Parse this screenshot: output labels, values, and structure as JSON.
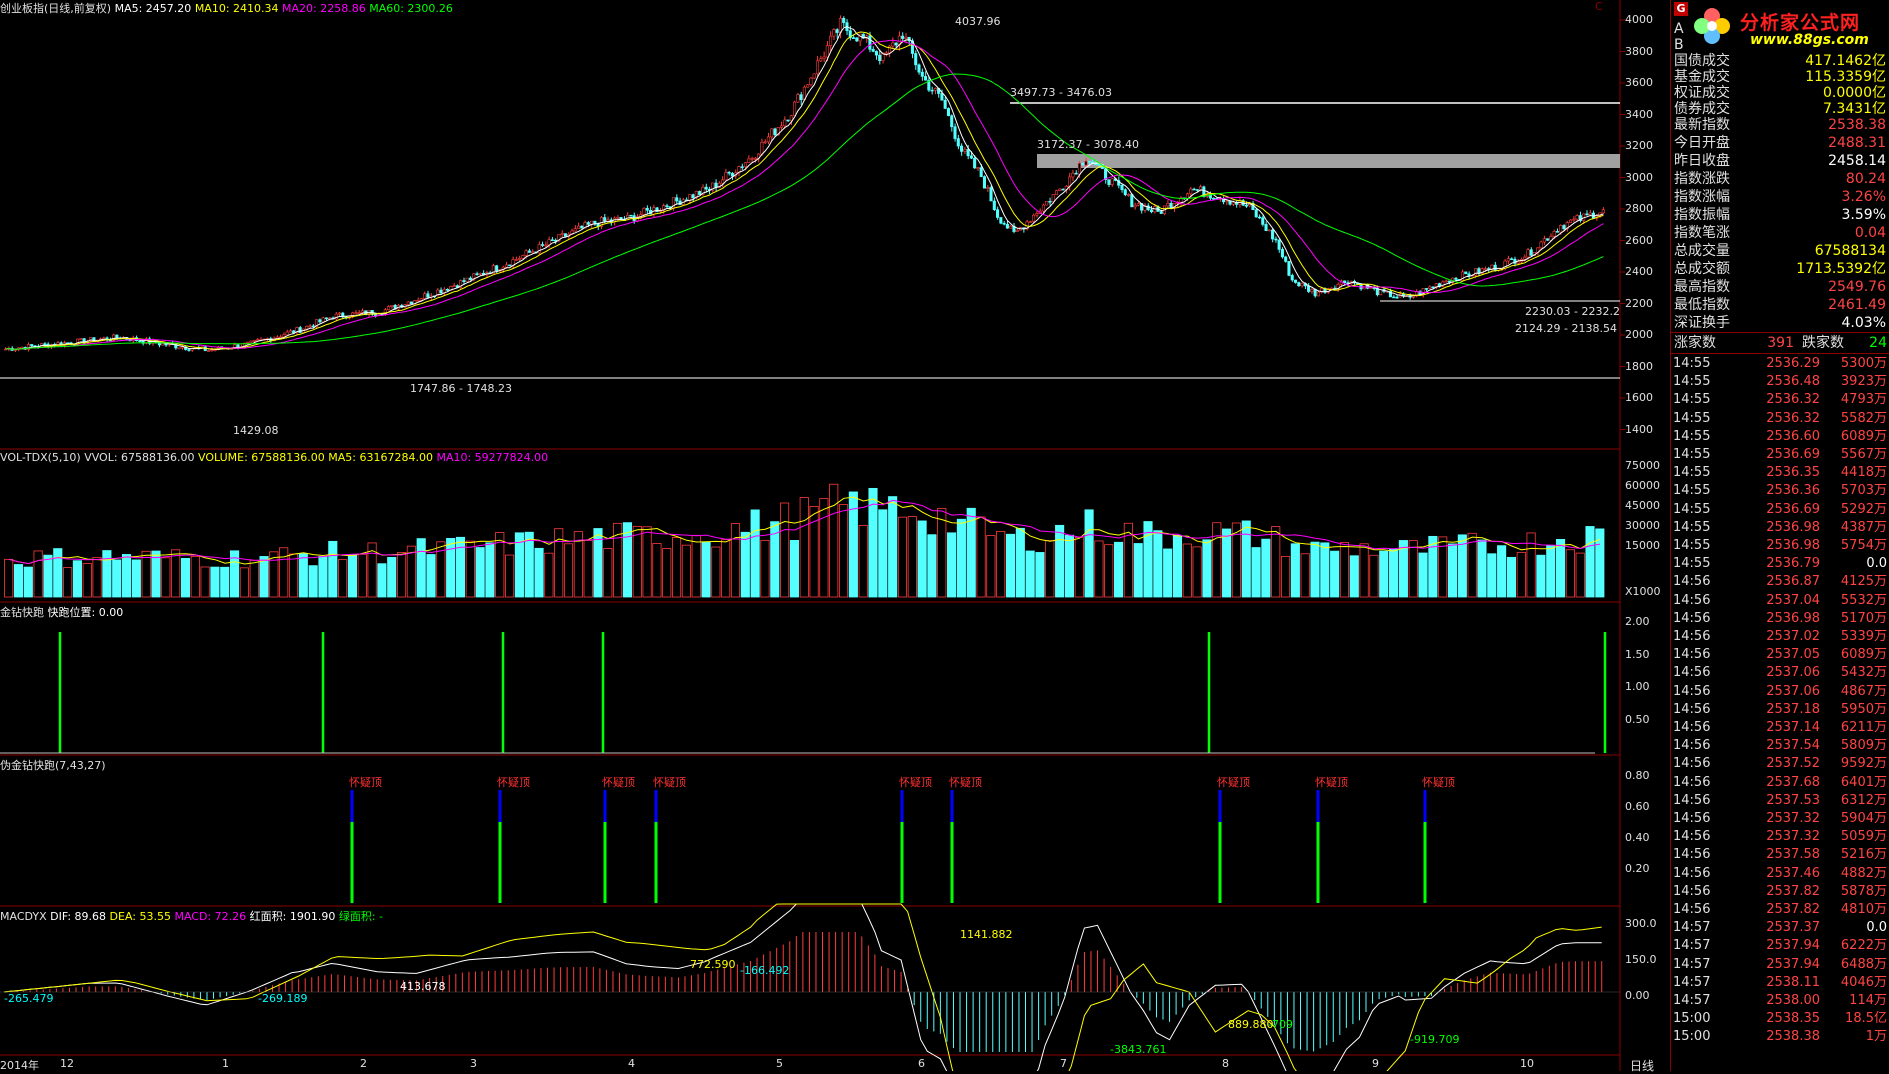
{
  "main_panel": {
    "title": "创业板指(日线,前复权)",
    "ma": [
      {
        "label": "MA5: 2457.20",
        "color": "#ffffff"
      },
      {
        "label": "MA10: 2410.34",
        "color": "#ffff00"
      },
      {
        "label": "MA20: 2258.86",
        "color": "#ff00ff"
      },
      {
        "label": "MA60: 2300.26",
        "color": "#00ff00"
      }
    ],
    "price_axis": [
      "4000",
      "3800",
      "3600",
      "3400",
      "3200",
      "3000",
      "2800",
      "2600",
      "2400",
      "2200",
      "2000",
      "1800",
      "1600",
      "1400"
    ],
    "annotations": [
      "4037.96",
      "3497.73 - 3476.03",
      "3172.37 - 3078.40",
      "1747.86 - 1748.23",
      "1429.08",
      "2230.03 - 2232.2",
      "2124.29 - 2138.54"
    ]
  },
  "vol_panel": {
    "title": "VOL-TDX(5,10)",
    "vvol": "VVOL: 67588136.00",
    "volume": "VOLUME: 67588136.00",
    "ma5": "MA5: 63167284.00",
    "ma10": "MA10: 59277824.00",
    "axis": [
      "75000",
      "60000",
      "45000",
      "30000",
      "15000"
    ],
    "unit": "X1000"
  },
  "jzkp_panel": {
    "title": "金钻快跑",
    "pos": "快跑位置: 0.00",
    "axis": [
      "2.00",
      "1.50",
      "1.00",
      "0.50"
    ]
  },
  "fjz_panel": {
    "title": "伪金钻快跑(7,43,27)",
    "signal_label": "怀疑顶",
    "axis": [
      "0.80",
      "0.60",
      "0.40",
      "0.20"
    ]
  },
  "macd_panel": {
    "title": "MACDYX",
    "dif": "DIF: 89.68",
    "dea": "DEA: 53.55",
    "macd": "MACD: 72.26",
    "red_area": "红面积: 1901.90",
    "green_area": "绿面积: -",
    "axis": [
      "300.0",
      "150.0",
      "0.00"
    ],
    "annotations": [
      "1141.882",
      "772.590",
      "-166.492",
      "-265.479",
      "-269.189",
      "413.678",
      "889.880",
      "-709",
      "-3843.761",
      "-919.709"
    ]
  },
  "date_axis": [
    "2014年",
    "12",
    "1",
    "2",
    "3",
    "4",
    "5",
    "6",
    "7",
    "8",
    "9",
    "10"
  ],
  "period_label": "日线",
  "top_right_label": "C",
  "logo": {
    "title": "分析家公式网",
    "url": "www.88gs.com"
  },
  "side_panel": {
    "badge": "G",
    "rows_top": [
      {
        "label": "A",
        "value": ""
      },
      {
        "label": "B",
        "value": ""
      },
      {
        "label": "国债成交",
        "value": "417.1462亿",
        "color": "#ffff00"
      },
      {
        "label": "基金成交",
        "value": "115.3359亿",
        "color": "#ffff00"
      },
      {
        "label": "权证成交",
        "value": "0.0000亿",
        "color": "#ffff00"
      },
      {
        "label": "债券成交",
        "value": "7.3431亿",
        "color": "#ffff00"
      }
    ],
    "rows_index": [
      {
        "label": "最新指数",
        "value": "2538.38",
        "color": "#ff4444"
      },
      {
        "label": "今日开盘",
        "value": "2488.31",
        "color": "#ff4444"
      },
      {
        "label": "昨日收盘",
        "value": "2458.14",
        "color": "#ffffff"
      },
      {
        "label": "指数涨跌",
        "value": "80.24",
        "color": "#ff4444"
      },
      {
        "label": "指数涨幅",
        "value": "3.26%",
        "color": "#ff4444"
      },
      {
        "label": "指数振幅",
        "value": "3.59%",
        "color": "#ffffff"
      },
      {
        "label": "指数笔涨",
        "value": "0.04",
        "color": "#ff4444"
      },
      {
        "label": "总成交量",
        "value": "67588134",
        "color": "#ffff00"
      },
      {
        "label": "总成交额",
        "value": "1713.5392亿",
        "color": "#ffff00"
      },
      {
        "label": "最高指数",
        "value": "2549.76",
        "color": "#ff4444"
      },
      {
        "label": "最低指数",
        "value": "2461.49",
        "color": "#ff4444"
      },
      {
        "label": "深证换手",
        "value": "4.03%",
        "color": "#ffffff"
      }
    ],
    "up_label": "涨家数",
    "up_value": "391",
    "down_label": "跌家数",
    "down_value": "24",
    "ticks": [
      [
        "14:55",
        "2536.29",
        "5300万"
      ],
      [
        "14:55",
        "2536.48",
        "3923万"
      ],
      [
        "14:55",
        "2536.32",
        "4793万"
      ],
      [
        "14:55",
        "2536.32",
        "5582万"
      ],
      [
        "14:55",
        "2536.60",
        "6089万"
      ],
      [
        "14:55",
        "2536.69",
        "5567万"
      ],
      [
        "14:55",
        "2536.35",
        "4418万"
      ],
      [
        "14:55",
        "2536.36",
        "5703万"
      ],
      [
        "14:55",
        "2536.69",
        "5292万"
      ],
      [
        "14:55",
        "2536.98",
        "4387万"
      ],
      [
        "14:55",
        "2536.98",
        "5754万"
      ],
      [
        "14:55",
        "2536.79",
        "0.0"
      ],
      [
        "14:56",
        "2536.87",
        "4125万"
      ],
      [
        "14:56",
        "2537.04",
        "5532万"
      ],
      [
        "14:56",
        "2536.98",
        "5170万"
      ],
      [
        "14:56",
        "2537.02",
        "5339万"
      ],
      [
        "14:56",
        "2537.05",
        "6089万"
      ],
      [
        "14:56",
        "2537.06",
        "5432万"
      ],
      [
        "14:56",
        "2537.06",
        "4867万"
      ],
      [
        "14:56",
        "2537.18",
        "5950万"
      ],
      [
        "14:56",
        "2537.14",
        "6211万"
      ],
      [
        "14:56",
        "2537.54",
        "5809万"
      ],
      [
        "14:56",
        "2537.52",
        "9592万"
      ],
      [
        "14:56",
        "2537.68",
        "6401万"
      ],
      [
        "14:56",
        "2537.53",
        "6312万"
      ],
      [
        "14:56",
        "2537.32",
        "5904万"
      ],
      [
        "14:56",
        "2537.32",
        "5059万"
      ],
      [
        "14:56",
        "2537.58",
        "5216万"
      ],
      [
        "14:56",
        "2537.46",
        "4882万"
      ],
      [
        "14:56",
        "2537.82",
        "5878万"
      ],
      [
        "14:56",
        "2537.82",
        "4810万"
      ],
      [
        "14:57",
        "2537.37",
        "0.0"
      ],
      [
        "14:57",
        "2537.94",
        "6222万"
      ],
      [
        "14:57",
        "2537.94",
        "6488万"
      ],
      [
        "14:57",
        "2538.11",
        "4046万"
      ],
      [
        "14:57",
        "2538.00",
        "114万"
      ],
      [
        "15:00",
        "2538.35",
        "18.5亿"
      ],
      [
        "15:00",
        "2538.38",
        "1万"
      ]
    ]
  }
}
